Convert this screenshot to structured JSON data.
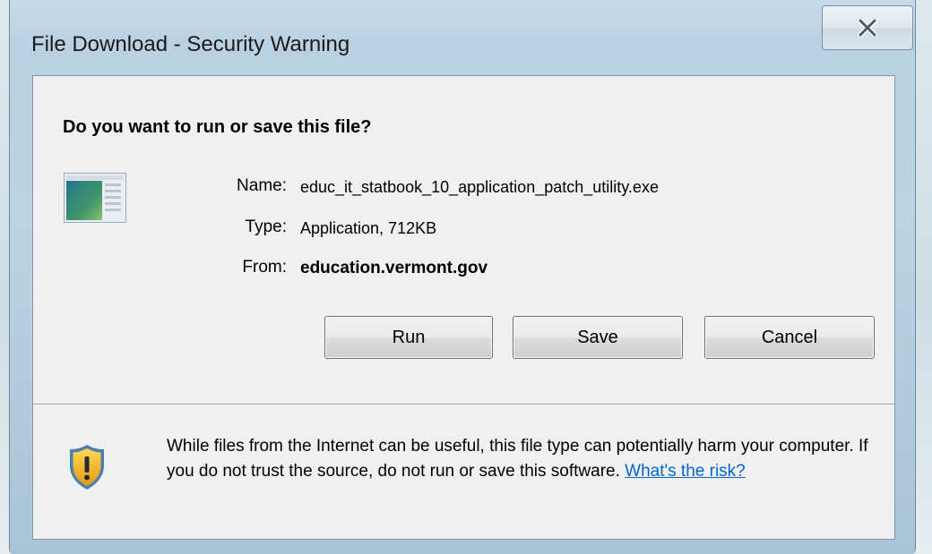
{
  "window": {
    "title": "File Download - Security Warning"
  },
  "dialog": {
    "question": "Do you want to run or save this file?",
    "file_icon": "application-window-icon",
    "fields": {
      "name_label": "Name:",
      "name_value": "educ_it_statbook_10_application_patch_utility.exe",
      "type_label": "Type:",
      "type_value": "Application, 712KB",
      "from_label": "From:",
      "from_value": "education.vermont.gov"
    },
    "buttons": {
      "run": "Run",
      "save": "Save",
      "cancel": "Cancel"
    },
    "warning": {
      "icon": "shield-warning-icon",
      "text": "While files from the Internet can be useful, this file type can potentially harm your computer. If you do not trust the source, do not run or save this software.",
      "link": "What's the risk?"
    }
  },
  "colors": {
    "link": "#0066cc",
    "client_bg": "#f0f0f0",
    "shield_gold": "#f2b51c",
    "shield_rim": "#4f7fae"
  }
}
